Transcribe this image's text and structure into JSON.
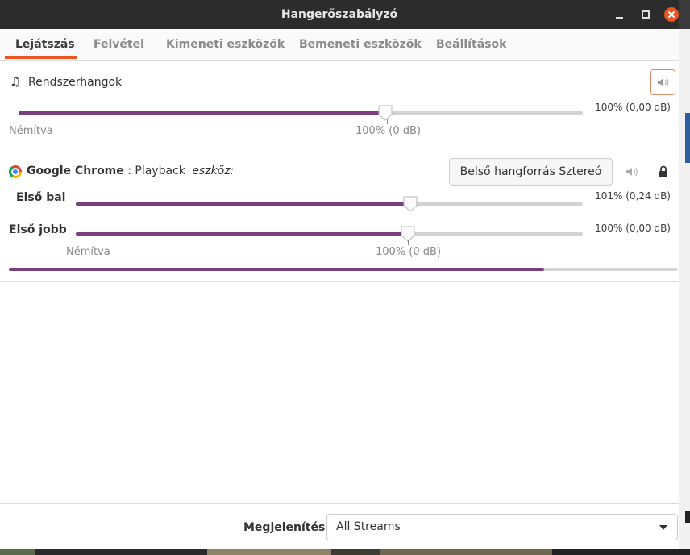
{
  "window": {
    "title": "Hangerőszabályzó"
  },
  "tabs": [
    {
      "label": "Lejátszás",
      "active": true
    },
    {
      "label": "Felvétel",
      "active": false
    },
    {
      "label": "Kimeneti eszközök",
      "active": false
    },
    {
      "label": "Bemeneti eszközök",
      "active": false
    },
    {
      "label": "Beállítások",
      "active": false
    }
  ],
  "system_sounds": {
    "icon": "music-note-icon",
    "name": "Rendszerhangok",
    "volume_fraction": 0.65,
    "volume_text": "100% (0,00 dB)",
    "muted_label": "Némítva",
    "base_label": "100% (0 dB)",
    "mute_icon": "speaker-muted-icon"
  },
  "stream": {
    "app_name": "Google Chrome",
    "separator": " : ",
    "stream_name": "Playback",
    "device_label": "eszköz:",
    "device_button": "Belső hangforrás Sztereó",
    "mute_icon": "speaker-icon",
    "lock_icon": "lock-icon",
    "channels": [
      {
        "label": "Első bal",
        "volume_fraction": 0.66,
        "volume_text": "101% (0,24 dB)"
      },
      {
        "label": "Első jobb",
        "volume_fraction": 0.655,
        "volume_text": "100% (0,00 dB)"
      }
    ],
    "muted_label": "Némítva",
    "base_label": "100% (0 dB)",
    "level_fraction": 0.8
  },
  "footer": {
    "show_label": "Megjelenítés:",
    "show_value": "All Streams"
  },
  "colors": {
    "accent": "#e95420",
    "slider_fill": "#7a3f7e",
    "titlebar": "#2c2c2c"
  }
}
